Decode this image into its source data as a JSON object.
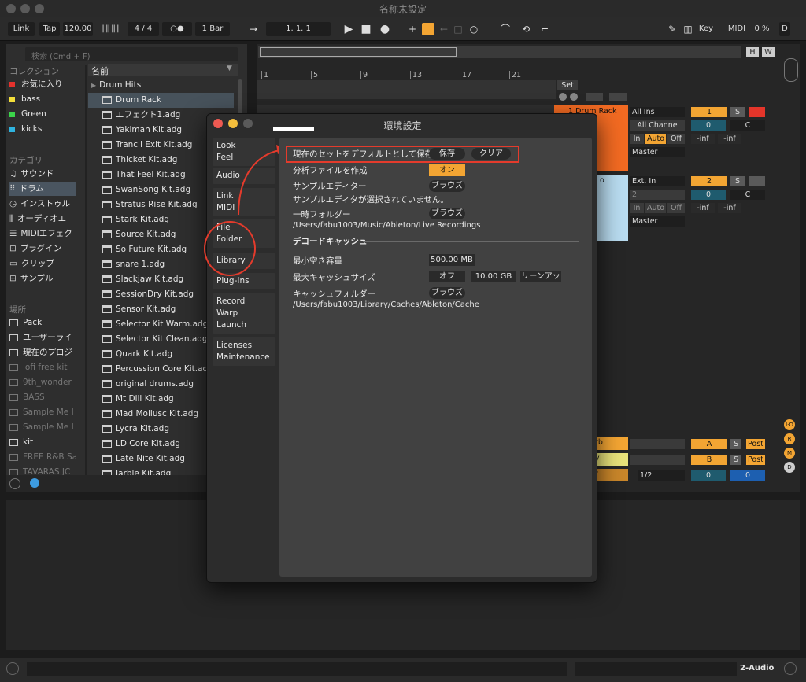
{
  "window": {
    "title": "名称未設定"
  },
  "control_bar": {
    "link": "Link",
    "tap": "Tap",
    "tempo": "120.00",
    "signature": "4 / 4",
    "metronome": "○●",
    "quantize": "1 Bar",
    "position": "1.   1.   1",
    "key": "Key",
    "midi": "MIDI",
    "cpu": "0 %",
    "d": "D"
  },
  "browser": {
    "search_placeholder": "検索 (Cmd + F)",
    "collections_header": "コレクション",
    "collections": [
      {
        "label": "お気に入り",
        "color": "#e5322d"
      },
      {
        "label": "bass",
        "color": "#f4df3a"
      },
      {
        "label": "Green",
        "color": "#3bd44a"
      },
      {
        "label": "kicks",
        "color": "#2fb4e0"
      }
    ],
    "categories_header": "カテゴリ",
    "categories": [
      "サウンド",
      "ドラム",
      "インストゥル",
      "オーディオエ",
      "MIDIエフェク",
      "プラグイン",
      "クリップ",
      "サンプル"
    ],
    "places_header": "場所",
    "places": [
      "Pack",
      "ユーザーライ",
      "現在のプロジ",
      "lofi free kit",
      "9th_wonder",
      "BASS",
      "Sample Me I",
      "Sample Me I",
      "kit",
      "FREE R&B Sa",
      "TAVARAS JC"
    ],
    "name_header": "名前",
    "folder": "Drum Hits",
    "files": [
      "Drum Rack",
      "エフェクト1.adg",
      "Yakiman Kit.adg",
      "Trancil Exit Kit.adg",
      "Thicket Kit.adg",
      "That Feel Kit.adg",
      "SwanSong Kit.adg",
      "Stratus Rise Kit.adg",
      "Stark Kit.adg",
      "Source Kit.adg",
      "So Future Kit.adg",
      "snare 1.adg",
      "Slackjaw Kit.adg",
      "SessionDry Kit.adg",
      "Sensor Kit.adg",
      "Selector Kit Warm.adg",
      "Selector Kit Clean.adg",
      "Quark Kit.adg",
      "Percussion Core Kit.adg",
      "original drums.adg",
      "Mt Dill Kit.adg",
      "Mad Mollusc Kit.adg",
      "Lycra Kit.adg",
      "LD Core Kit.adg",
      "Late Nite Kit.adg",
      "Jarble Kit.adg"
    ]
  },
  "arrangement": {
    "ruler": [
      "1",
      "5",
      "9",
      "13",
      "17",
      "21"
    ],
    "set_label": "Set",
    "h": "H",
    "w": "W",
    "track1": {
      "name": "1 Drum Rack",
      "input": "All Ins",
      "channel": "All Channe",
      "in": "In",
      "auto": "Auto",
      "off": "Off",
      "out": "Master",
      "num": "1",
      "s": "S",
      "vol": "0",
      "pan": "C",
      "inf1": "-inf",
      "inf2": "-inf"
    },
    "track2": {
      "name": "o",
      "input": "Ext. In",
      "channel": "2",
      "in": "In",
      "auto": "Auto",
      "off": "Off",
      "out": "Master",
      "num": "2",
      "s": "S",
      "vol": "0",
      "pan": "C",
      "inf1": "-inf",
      "inf2": "-inf"
    },
    "returns": [
      {
        "name": "rb",
        "letter": "A",
        "s": "S",
        "post": "Post"
      },
      {
        "name": "y",
        "letter": "B",
        "s": "S",
        "post": "Post"
      }
    ],
    "master": {
      "name": "r",
      "sel": "1/2",
      "vol": "0",
      "pan": "0"
    },
    "side_letters": [
      "I·O",
      "R",
      "M",
      "D"
    ]
  },
  "modal": {
    "title": "環境設定",
    "tabs": [
      [
        "Look",
        "Feel"
      ],
      [
        "Audio"
      ],
      [
        "Link",
        "MIDI"
      ],
      [
        "File",
        "Folder"
      ],
      [
        "Library"
      ],
      [
        "Plug-Ins"
      ],
      [
        "Record",
        "Warp",
        "Launch"
      ],
      [
        "Licenses",
        "Maintenance"
      ]
    ],
    "default_set_label": "現在のセットをデフォルトとして保存",
    "save_btn": "保存",
    "clear_btn": "クリア",
    "analysis_label": "分析ファイルを作成",
    "analysis_value": "オン",
    "sample_editor_label": "サンプルエディター",
    "browse": "ブラウズ",
    "sample_editor_note": "サンプルエディタが選択されていません。",
    "temp_folder_label": "一時フォルダー",
    "temp_folder_path": "/Users/fabu1003/Music/Ableton/Live Recordings",
    "decode_cache_header": "デコードキャッシュ",
    "min_free_label": "最小空き容量",
    "min_free_value": "500.00 MB",
    "max_cache_label": "最大キャッシュサイズ",
    "max_cache_toggle": "オフ",
    "max_cache_value": "10.00 GB",
    "cleanup_btn": "リーンアッ",
    "cache_folder_label": "キャッシュフォルダー",
    "cache_folder_path": "/Users/fabu1003/Library/Caches/Ableton/Cache"
  },
  "bottom": {
    "track_label": "2-Audio"
  }
}
